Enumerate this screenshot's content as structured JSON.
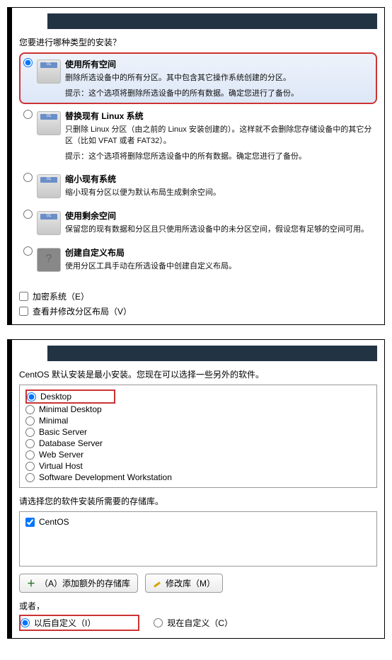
{
  "panel1": {
    "prompt": "您要进行哪种类型的安装？",
    "options": [
      {
        "title": "使用所有空间",
        "desc": "删除所选设备中的所有分区。其中包含其它操作系统创建的分区。",
        "hint": "提示：这个选项将删除所选设备中的所有数据。确定您进行了备份。"
      },
      {
        "title": "替换现有 Linux 系统",
        "desc": "只删除 Linux 分区（由之前的 Linux 安装创建的）。这样就不会删除您存储设备中的其它分区（比如 VFAT 或者 FAT32）。",
        "hint": "提示：这个选项将删除您所选设备中的所有数据。确定您进行了备份。"
      },
      {
        "title": "缩小现有系统",
        "desc": "缩小现有分区以便为默认布局生成剩余空间。",
        "hint": ""
      },
      {
        "title": "使用剩余空间",
        "desc": "保留您的现有数据和分区且只使用所选设备中的未分区空间，假设您有足够的空间可用。",
        "hint": ""
      },
      {
        "title": "创建自定义布局",
        "desc": "使用分区工具手动在所选设备中创建自定义布局。",
        "hint": ""
      }
    ],
    "encrypt": "加密系统（E）",
    "review": "查看并修改分区布局（V）"
  },
  "panel2": {
    "prompt": "CentOS 默认安装是最小安装。您现在可以选择一些另外的软件。",
    "software": [
      "Desktop",
      "Minimal Desktop",
      "Minimal",
      "Basic Server",
      "Database Server",
      "Web Server",
      "Virtual Host",
      "Software Development Workstation"
    ],
    "repo_prompt": "请选择您的软件安装所需要的存储库。",
    "repo_item": "CentOS",
    "btn_add": "（A）添加额外的存储库",
    "btn_modify": "修改库（M）",
    "or_label": "或者，",
    "later_custom": "以后自定义（I）",
    "now_custom": "现在自定义（C）"
  }
}
